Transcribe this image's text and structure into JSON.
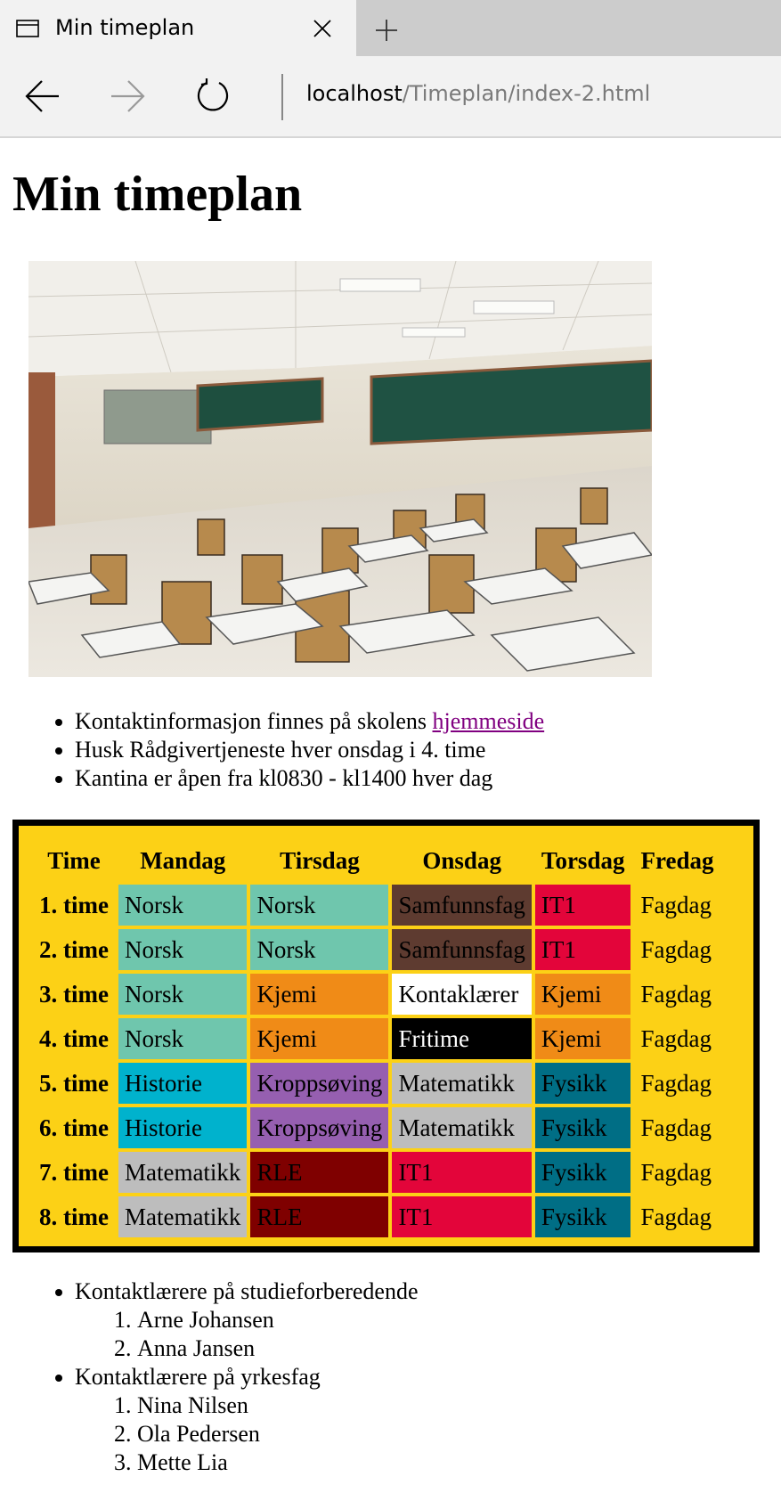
{
  "browser": {
    "tab_title": "Min timeplan",
    "address_host": "localhost",
    "address_path": "/Timeplan/index-2.html"
  },
  "page": {
    "title": "Min timeplan",
    "info_list": {
      "item1_text": "Kontaktinformasjon finnes på skolens ",
      "item1_link": "hjemmeside",
      "item2": "Husk Rådgivertjeneste hver onsdag i 4. time",
      "item3": "Kantina er åpen fra kl0830 - kl1400 hver dag"
    },
    "schedule": {
      "headers": [
        "Time",
        "Mandag",
        "Tirsdag",
        "Onsdag",
        "Torsdag",
        "Fredag"
      ],
      "rows": [
        {
          "time": "1. time",
          "cells": [
            "Norsk",
            "Norsk",
            "Samfunnsfag",
            "IT1",
            "Fagdag"
          ]
        },
        {
          "time": "2. time",
          "cells": [
            "Norsk",
            "Norsk",
            "Samfunnsfag",
            "IT1",
            "Fagdag"
          ]
        },
        {
          "time": "3. time",
          "cells": [
            "Norsk",
            "Kjemi",
            "Kontaklærer",
            "Kjemi",
            "Fagdag"
          ]
        },
        {
          "time": "4. time",
          "cells": [
            "Norsk",
            "Kjemi",
            "Fritime",
            "Kjemi",
            "Fagdag"
          ]
        },
        {
          "time": "5. time",
          "cells": [
            "Historie",
            "Kroppsøving",
            "Matematikk",
            "Fysikk",
            "Fagdag"
          ]
        },
        {
          "time": "6. time",
          "cells": [
            "Historie",
            "Kroppsøving",
            "Matematikk",
            "Fysikk",
            "Fagdag"
          ]
        },
        {
          "time": "7. time",
          "cells": [
            "Matematikk",
            "RLE",
            "IT1",
            "Fysikk",
            "Fagdag"
          ]
        },
        {
          "time": "8. time",
          "cells": [
            "Matematikk",
            "RLE",
            "IT1",
            "Fysikk",
            "Fagdag"
          ]
        }
      ],
      "colors": {
        "frame": "#000000",
        "background": "#fcd116",
        "norsk": "#6fc6ad",
        "samfunnsfag": "#5e3b30",
        "it1": "#e3053a",
        "kjemi": "#f08b17",
        "kontaklaerer": "#ffffff",
        "fritime": "#000000",
        "historie": "#00b2cd",
        "kroppsoving": "#965fb0",
        "matematikk": "#bdbdbd",
        "fysikk": "#006e85",
        "rle": "#7f0000"
      }
    },
    "contacts": {
      "group1": {
        "label": "Kontaktlærere på studieforberedende",
        "names": [
          "Arne Johansen",
          "Anna Jansen"
        ]
      },
      "group2": {
        "label": "Kontaktlærere på yrkesfag",
        "names": [
          "Nina Nilsen",
          "Ola Pedersen",
          "Mette Lia"
        ]
      }
    }
  },
  "icons": {
    "tab": "tab-icon",
    "close": "close-icon",
    "new_tab": "plus-icon",
    "back": "arrow-left-icon",
    "forward": "arrow-right-icon",
    "refresh": "refresh-icon"
  }
}
